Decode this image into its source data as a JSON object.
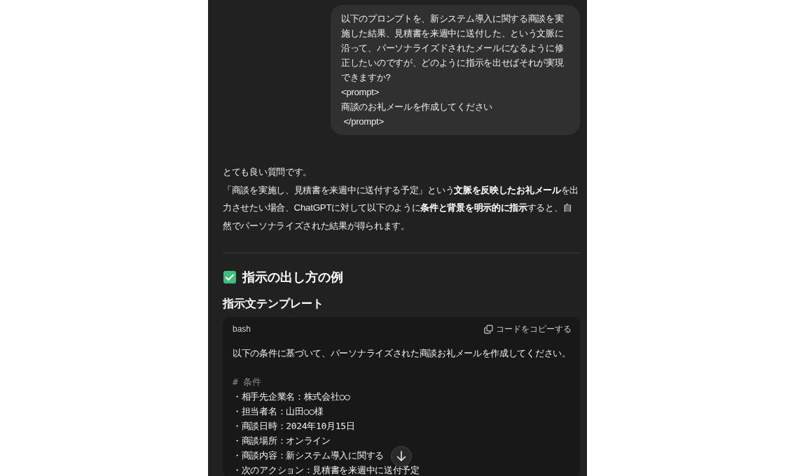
{
  "user_message": {
    "lines": [
      "以下のプロンプトを、新システム導入に関する商談を実施した結果、見積書を来週中に送付した、という文脈に沿って、パーソナライズドされたメールになるように修正したいのですが、どのように指示を出せばそれが実現できますか?",
      "<prompt>",
      "商談のお礼メールを作成してください",
      " </prompt>"
    ]
  },
  "assistant_message": {
    "paragraphs": [
      "とても良い質問です。",
      "「商談を実施し、見積書を来週中に送付する予定」という**文脈を反映したお礼メール**を出力させたい場合、ChatGPTに対して以下のように**条件と背景を明示的に指示**すると、自然でパーソナライズされた結果が得られます。"
    ],
    "heading": "指示の出し方の例",
    "subheading": "指示文テンプレート",
    "code_block": {
      "language": "bash",
      "copy_label": "コードをコピーする",
      "lines": [
        {
          "kind": "text",
          "text": "以下の条件に基づいて、パーソナライズされた商談お礼メールを作成してください。"
        },
        {
          "kind": "comment",
          "text": "# 条件"
        },
        {
          "kind": "text",
          "text": "・相手先企業名：株式会社○○"
        },
        {
          "kind": "text",
          "text": "・担当者名：山田○○様"
        },
        {
          "kind": "text",
          "text": "・商談日時：2024年10月15日"
        },
        {
          "kind": "text",
          "text": "・商談場所：オンライン"
        },
        {
          "kind": "text",
          "text": "・商談内容：新システム導入に関する"
        },
        {
          "kind": "text",
          "text": "・次のアクション：見積書を来週中に送付予定"
        }
      ]
    }
  }
}
